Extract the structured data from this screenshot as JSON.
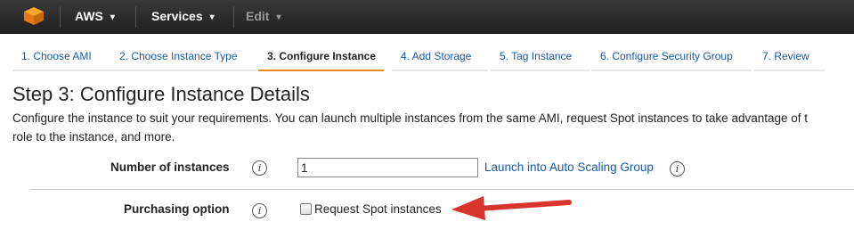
{
  "topbar": {
    "brand_label": "AWS",
    "services_label": "Services",
    "edit_label": "Edit",
    "chevron": "▾"
  },
  "wizard_tabs": [
    {
      "label": "1. Choose AMI",
      "active": false
    },
    {
      "label": "2. Choose Instance Type",
      "active": false
    },
    {
      "label": "3. Configure Instance",
      "active": true
    },
    {
      "label": "4. Add Storage",
      "active": false
    },
    {
      "label": "5. Tag Instance",
      "active": false
    },
    {
      "label": "6. Configure Security Group",
      "active": false
    },
    {
      "label": "7. Review",
      "active": false
    }
  ],
  "page": {
    "title": "Step 3: Configure Instance Details",
    "description_line1": "Configure the instance to suit your requirements. You can launch multiple instances from the same AMI, request Spot instances to take advantage of t",
    "description_line2": "role to the instance, and more."
  },
  "form": {
    "instances_label": "Number of instances",
    "instances_value": "1",
    "auto_scaling_link": "Launch into Auto Scaling Group",
    "purchasing_label": "Purchasing option",
    "spot_label": "Request Spot instances",
    "spot_checked": false,
    "info_glyph": "i"
  },
  "colors": {
    "accent_tab": "#e8891d",
    "link": "#1a5aa8",
    "arrow": "#d9332e",
    "topbar": "#2b2b2b"
  }
}
